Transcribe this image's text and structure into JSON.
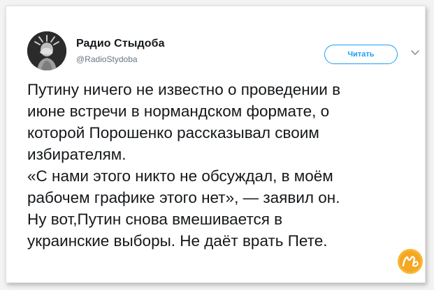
{
  "account": {
    "name": "Радио Стыдоба",
    "handle": "@RadioStydoba"
  },
  "actions": {
    "follow_label": "Читать"
  },
  "icons": {
    "avatar": "statue-of-liberty-facepalm-avatar",
    "menu": "chevron-down-icon",
    "watermark": "nyuka-logo"
  },
  "tweet": {
    "lines": [
      "Путину ничего не известно о проведении в",
      "июне встречи в нормандском формате, о",
      "которой Порошенко рассказывал своим",
      "избирателям.",
      "«С нами этого никто не обсуждал, в моём",
      "рабочем графике этого нет», — заявил он.",
      "Ну вот,Путин снова вмешивается в",
      "украинские выборы. Не даёт врать Пете."
    ]
  },
  "colors": {
    "accent": "#1da1f2",
    "text": "#14171a",
    "secondary": "#657786",
    "watermark": "#f5a623"
  }
}
